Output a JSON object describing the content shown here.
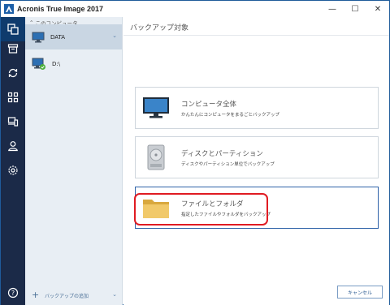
{
  "window": {
    "title": "Acronis True Image 2017",
    "controls": {
      "minimize": "—",
      "maximize": "☐",
      "close": "✕"
    }
  },
  "rail": {
    "items": [
      {
        "icon": "backup-icon",
        "active": true
      },
      {
        "icon": "archive-icon"
      },
      {
        "icon": "sync-icon"
      },
      {
        "icon": "dashboard-icon"
      },
      {
        "icon": "devices-icon"
      },
      {
        "icon": "account-icon"
      },
      {
        "icon": "settings-icon"
      }
    ],
    "help_icon": "help-icon"
  },
  "sources": {
    "back_label": "このコンピュータ",
    "items": [
      {
        "label": "DATA",
        "selected": true
      },
      {
        "label": "D:\\",
        "selected": false
      }
    ],
    "add_backup_label": "バックアップの追加"
  },
  "main": {
    "title": "バックアップ対象",
    "options": [
      {
        "title": "コンピュータ全体",
        "subtitle": "かんたんにコンピュータをまるごとバックアップ",
        "icon": "computer-icon"
      },
      {
        "title": "ディスクとパーティション",
        "subtitle": "ディスクやパーティション単位でバックアップ",
        "icon": "hard-disk-icon"
      },
      {
        "title": "ファイルとフォルダ",
        "subtitle": "指定したファイルやフォルダをバックアップ",
        "icon": "folder-icon"
      }
    ],
    "cancel_label": "キャンセル"
  },
  "colors": {
    "rail": "#1b2a48",
    "rail_active": "#0f3b6d",
    "sources_bg": "#e8eef4",
    "selected_bg": "#c9d6e3",
    "highlight": "#e01b22",
    "accent": "#2e62a8"
  }
}
